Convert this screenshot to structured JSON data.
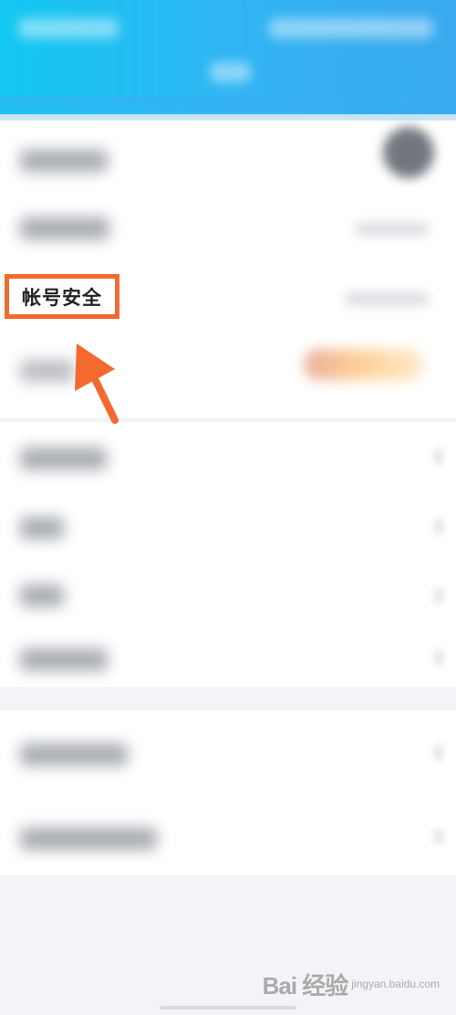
{
  "settings": {
    "account_security_label": "帐号安全"
  },
  "watermark": {
    "brand": "Bai 经验",
    "sub": "jingyan.baidu.com"
  },
  "colors": {
    "header_start": "#13c8f2",
    "header_end": "#3aa9ef",
    "highlight": "#f26a2e",
    "background": "#f3f4f7"
  }
}
